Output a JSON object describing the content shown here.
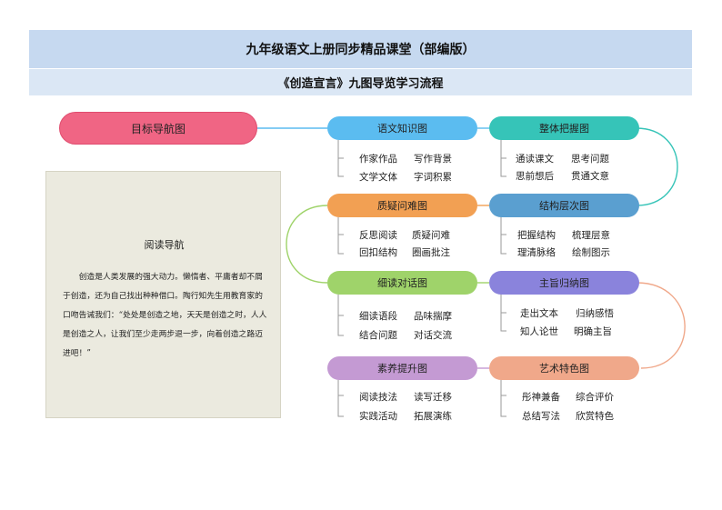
{
  "header": {
    "title": "九年级语文上册同步精品课堂（部编版）",
    "subtitle": "《创造宣言》九图导览学习流程"
  },
  "root": {
    "label": "目标导航图"
  },
  "reading_panel": {
    "title": "阅读导航",
    "body": "创造是人类发展的强大动力。懒惰者、平庸者却不屑于创造，还为自己找出种种借口。陶行知先生用教育家的口吻告诫我们：“处处是创造之地，天天是创造之时，人人是创造之人，让我们至少走两步退一步，向着创造之路迈进吧！”"
  },
  "nodes": [
    {
      "label": "语文知识图",
      "color": "#5bbcf0",
      "leaves": [
        "作家作品",
        "写作背景",
        "文学文体",
        "字词积累"
      ]
    },
    {
      "label": "整体把握图",
      "color": "#36c4b8",
      "leaves": [
        "通读课文",
        "思考问题",
        "思前想后",
        "贯通文意"
      ]
    },
    {
      "label": "质疑问难图",
      "color": "#f2a053",
      "leaves": [
        "反思阅读",
        "质疑问难",
        "回扣结构",
        "圈画批注"
      ]
    },
    {
      "label": "结构层次图",
      "color": "#5a9fd0",
      "leaves": [
        "把握结构",
        "梳理层意",
        "理清脉络",
        "绘制图示"
      ]
    },
    {
      "label": "细读对话图",
      "color": "#9fd36a",
      "leaves": [
        "细读语段",
        "品味揣摩",
        "结合问题",
        "对话交流"
      ]
    },
    {
      "label": "主旨归纳图",
      "color": "#8a83dc",
      "leaves": [
        "走出文本",
        "归纳感悟",
        "知人论世",
        "明确主旨"
      ]
    },
    {
      "label": "素养提升图",
      "color": "#c49ad3",
      "leaves": [
        "阅读技法",
        "读写迁移",
        "实践活动",
        "拓展演练"
      ]
    },
    {
      "label": "艺术特色图",
      "color": "#f0a88a",
      "leaves": [
        "彤神兼备",
        "综合评价",
        "总结写法",
        "欣赏特色"
      ]
    }
  ],
  "colors": {
    "connector_top": "#5bbcf0",
    "connector_right1": "#36c4b8",
    "connector_left": "#9fd36a",
    "connector_right2": "#f0a88a"
  }
}
